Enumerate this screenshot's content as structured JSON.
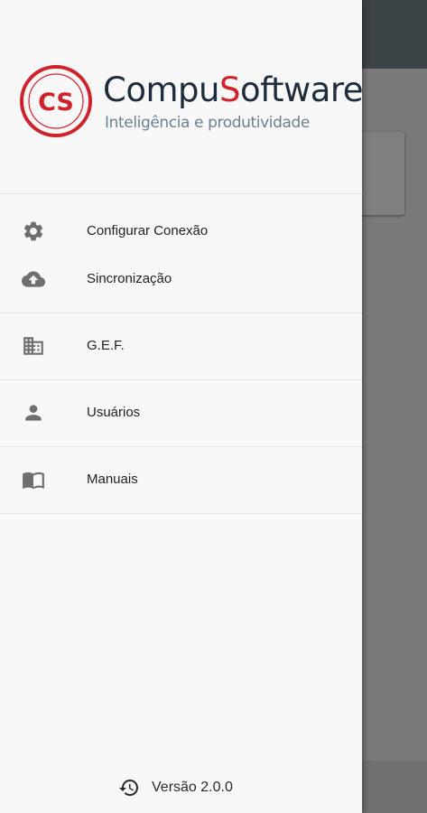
{
  "brand": {
    "logo_text": "CS",
    "name_part1": "Compu",
    "name_s": "S",
    "name_part2": "oftware",
    "tagline": "Inteligência e produtividade",
    "accent_color": "#d0222a",
    "name_color": "#1e2c3c"
  },
  "menu": {
    "items": [
      {
        "label": "Configurar Conexão",
        "icon": "gear-icon"
      },
      {
        "label": "Sincronização",
        "icon": "cloud-upload-icon"
      },
      {
        "label": "G.E.F.",
        "icon": "building-icon"
      },
      {
        "label": "Usuários",
        "icon": "person-icon"
      },
      {
        "label": "Manuais",
        "icon": "book-icon"
      }
    ]
  },
  "footer": {
    "version_label": "Versão 2.0.0",
    "icon": "history-icon"
  }
}
